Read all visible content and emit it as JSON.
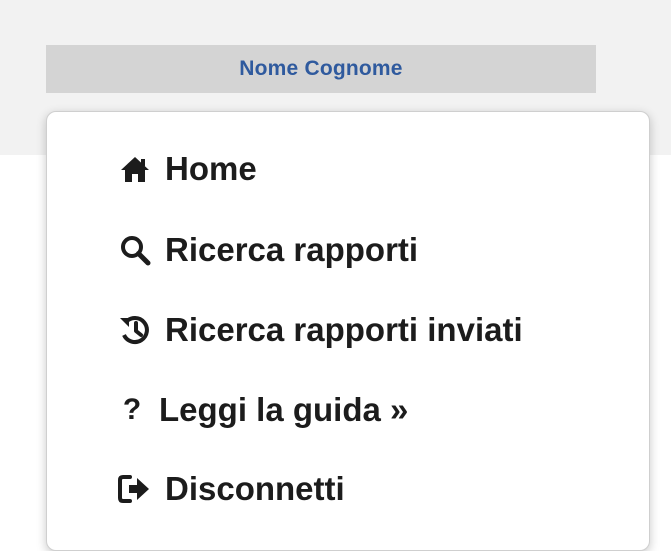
{
  "user": {
    "name": "Nome Cognome"
  },
  "menu": {
    "items": [
      {
        "label": "Home",
        "icon": "home-icon"
      },
      {
        "label": "Ricerca rapporti",
        "icon": "search-icon"
      },
      {
        "label": "Ricerca rapporti inviati",
        "icon": "history-icon"
      },
      {
        "label": "Leggi la guida »",
        "icon": "question-icon"
      },
      {
        "label": "Disconnetti",
        "icon": "sign-out-icon"
      }
    ]
  },
  "colors": {
    "user_name_text": "#2f5a9e",
    "user_bar_bg": "#d4d4d4",
    "header_band_bg": "#f2f2f2",
    "menu_text": "#1c1c1c"
  }
}
